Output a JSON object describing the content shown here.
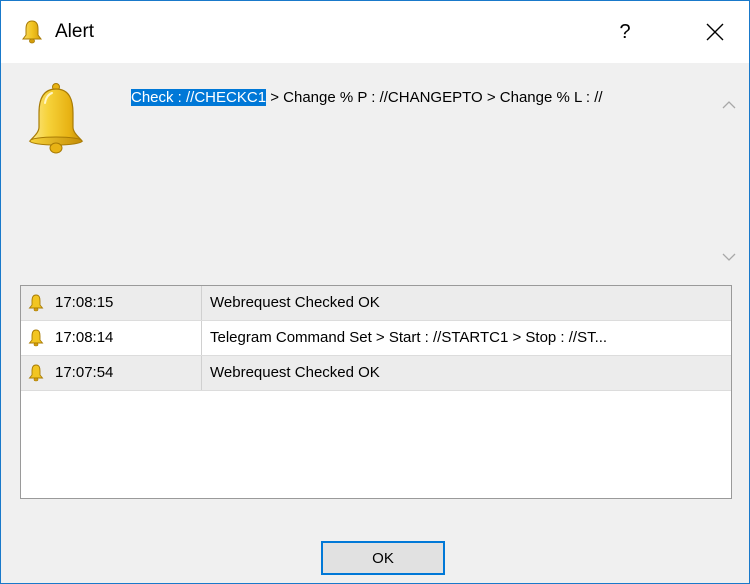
{
  "window": {
    "title": "Alert",
    "help_label": "?",
    "title_icon": "bell-icon",
    "close_icon": "close-icon"
  },
  "message": {
    "selected_text": "Check : //CHECKC1",
    "rest_text": " > Change % P : //CHANGEPTO > Change % L : //",
    "icon": "bell-icon"
  },
  "log": {
    "rows": [
      {
        "time": "17:08:15",
        "message": "Webrequest Checked OK",
        "icon": "bell-icon"
      },
      {
        "time": "17:08:14",
        "message": "Telegram Command Set > Start : //STARTC1 > Stop : //ST...",
        "icon": "bell-icon"
      },
      {
        "time": "17:07:54",
        "message": "Webrequest Checked OK",
        "icon": "bell-icon"
      }
    ]
  },
  "buttons": {
    "ok_label": "OK"
  },
  "colors": {
    "accent": "#0078d7",
    "window_border": "#1979ca",
    "bell": "#f2c522"
  }
}
